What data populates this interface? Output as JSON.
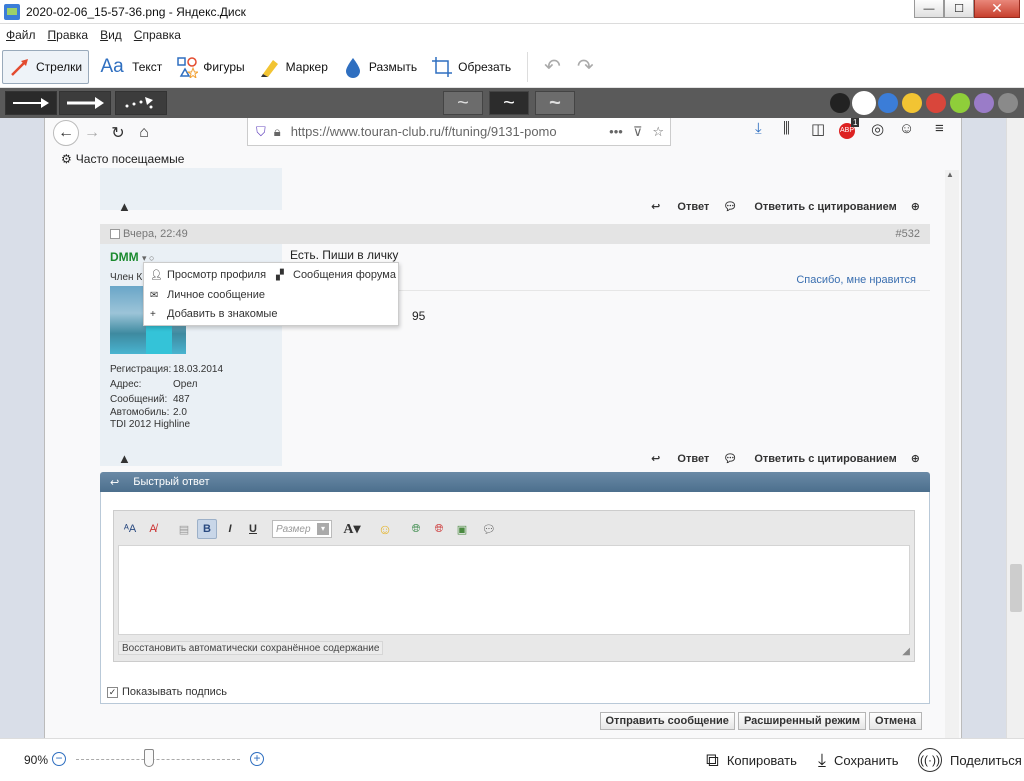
{
  "window": {
    "title": "2020-02-06_15-57-36.png - Яндекс.Диск",
    "minimize": "—",
    "maximize": "☐",
    "close": "✕"
  },
  "menu": [
    "Файл",
    "Правка",
    "Вид",
    "Справка"
  ],
  "tools": [
    {
      "label": "Стрелки",
      "icon": "arrow-icon"
    },
    {
      "label": "Текст",
      "icon": "text-icon"
    },
    {
      "label": "Фигуры",
      "icon": "shapes-icon"
    },
    {
      "label": "Маркер",
      "icon": "marker-icon"
    },
    {
      "label": "Размыть",
      "icon": "blur-icon"
    },
    {
      "label": "Обрезать",
      "icon": "crop-icon"
    }
  ],
  "active_tool": "Стрелки",
  "colors": [
    "#222222",
    "#ffffff",
    "#3b7dd8",
    "#f2c433",
    "#d9463b",
    "#8fce3a",
    "#9a7cc8",
    "#8a8a8a"
  ],
  "selected_color": "#ffffff",
  "browser": {
    "url": "https://www.touran-club.ru/f/tuning/9131-pomo",
    "bookmarks_label": "Часто посещаемые",
    "abp_badge": "1"
  },
  "post_actions": {
    "reply": "Ответ",
    "quote": "Ответить с цитированием"
  },
  "post": {
    "date": "Вчера, 22:49",
    "number": "#532",
    "username": "DMM",
    "rank": "Член К",
    "text": "Есть. Пиши в личку",
    "thanks": "Спасибо, мне нравится",
    "signature_fragment": "95",
    "info": [
      {
        "k": "Регистрация:",
        "v": "18.03.2014"
      },
      {
        "k": "Адрес:",
        "v": "Орел"
      },
      {
        "k": "Сообщений:",
        "v": "487"
      },
      {
        "k": "Автомобиль:",
        "v": "2.0"
      }
    ],
    "car_extra": "TDI 2012 Highline"
  },
  "popup": {
    "profile": "Просмотр профиля",
    "forum_msgs": "Сообщения форума",
    "pm": "Личное сообщение",
    "add_friend": "Добавить в знакомые"
  },
  "quick_reply": {
    "title": "Быстрый ответ",
    "size_placeholder": "Размер",
    "restore": "Восстановить автоматически сохранённое содержание",
    "show_signature": "Показывать подпись",
    "buttons": [
      "Отправить сообщение",
      "Расширенный режим",
      "Отмена"
    ]
  },
  "status": {
    "zoom": "90%",
    "copy": "Копировать",
    "save": "Сохранить",
    "share": "Поделиться"
  }
}
